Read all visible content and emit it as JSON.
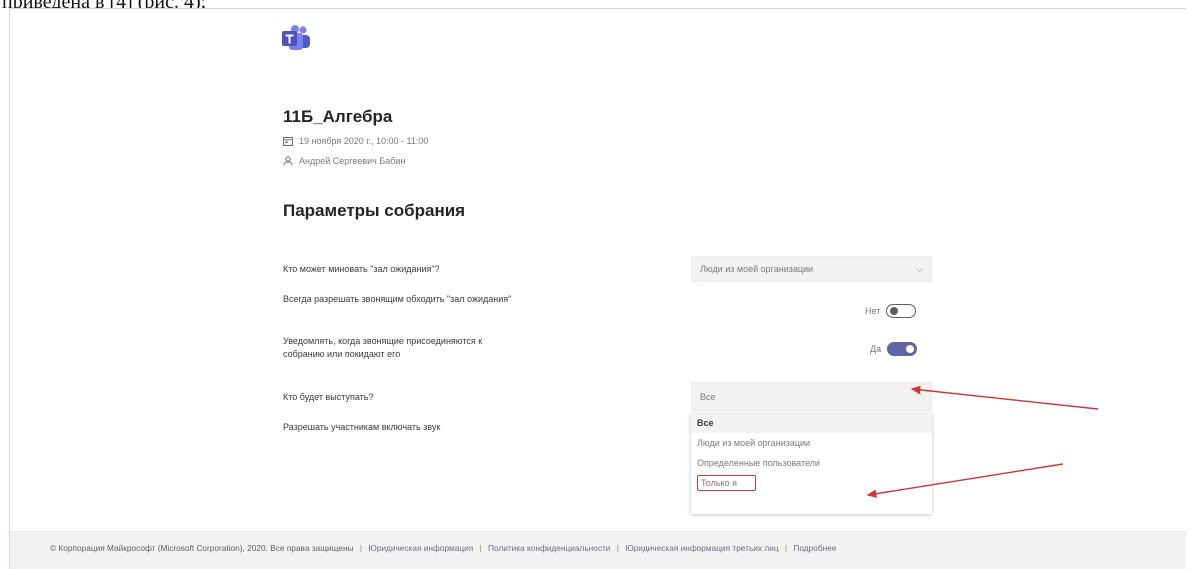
{
  "caption": "приведена в [4] (рис. 4);",
  "meeting": {
    "title": "11Б_Алгебра",
    "date": "19 ноября 2020 г., 10:00 - 11:00",
    "organizer": "Андрей Сергеевич Бабин"
  },
  "settings": {
    "section_title": "Параметры собрания",
    "lobby_label": "Кто может миновать \"зал ожидания\"?",
    "lobby_value": "Люди из моей организации",
    "bypass_label": "Всегда разрешать звонящим обходить \"зал ожидания\"",
    "bypass_state": "Нет",
    "notify_label_1": "Уведомлять, когда звонящие присоединяются к",
    "notify_label_2": "собранию или покидают его",
    "notify_state": "Да",
    "presenter_label": "Кто будет выступать?",
    "presenter_value": "Все",
    "unmute_label": "Разрешать участникам включать звук"
  },
  "presenter_menu": {
    "options": [
      "Все",
      "Люди из моей организации",
      "Определенные пользователи",
      "Только я"
    ],
    "selected": "Все"
  },
  "footer": {
    "copyright": "© Корпорация Майкрософт (Microsoft Corporation), 2020. Все права защищены",
    "links": [
      "Юридическая информация",
      "Политика конфиденциальности",
      "Юридическая информация третьих лиц",
      "Подробнее"
    ]
  },
  "colors": {
    "accent": "#6264a7",
    "annotation_arrow": "#d13438"
  }
}
